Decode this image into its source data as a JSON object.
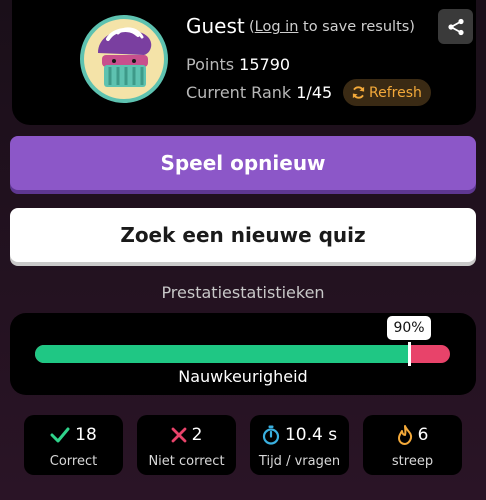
{
  "profile": {
    "name": "Guest",
    "login_open": "(",
    "login_link": "Log in",
    "login_rest": " to save results)",
    "points_label": "Points",
    "points_value": "15790",
    "rank_label": "Current Rank",
    "rank_value": "1/45",
    "refresh_label": "Refresh"
  },
  "actions": {
    "replay_label": "Speel opnieuw",
    "new_quiz_label": "Zoek een nieuwe quiz"
  },
  "performance": {
    "title": "Prestatiestatistieken",
    "accuracy_fraction": 0.9,
    "accuracy_text": "90%",
    "accuracy_label": "Nauwkeurigheid"
  },
  "stats": [
    {
      "value": "18",
      "label": "Correct",
      "icon": "checkmark-icon",
      "color": "#2fd38b"
    },
    {
      "value": "2",
      "label": "Niet correct",
      "icon": "cross-icon",
      "color": "#e8436a"
    },
    {
      "value": "10.4 s",
      "label": "Tijd / vragen",
      "icon": "stopwatch-icon",
      "color": "#3ab0e0"
    },
    {
      "value": "6",
      "label": "streep",
      "icon": "flame-icon",
      "color": "#f3a93a"
    }
  ],
  "colors": {
    "accent_purple": "#8c57c8",
    "correct_green": "#1fc784",
    "wrong_pink": "#e8436a",
    "refresh_orange": "#f3a93a"
  }
}
